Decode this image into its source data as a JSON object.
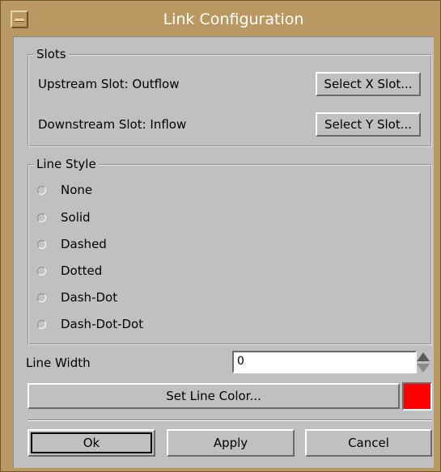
{
  "window": {
    "title": "Link Configuration"
  },
  "slots": {
    "group_label": "Slots",
    "upstream_label": "Upstream Slot: Outflow",
    "downstream_label": "Downstream Slot: Inflow",
    "select_x_label": "Select X Slot...",
    "select_y_label": "Select Y Slot..."
  },
  "line_style": {
    "group_label": "Line Style",
    "options": [
      "None",
      "Solid",
      "Dashed",
      "Dotted",
      "Dash-Dot",
      "Dash-Dot-Dot"
    ]
  },
  "line_width": {
    "label": "Line Width",
    "value": "0"
  },
  "line_color": {
    "button_label": "Set Line Color...",
    "color": "#ff0000"
  },
  "actions": {
    "ok_label": "Ok",
    "apply_label": "Apply",
    "cancel_label": "Cancel"
  }
}
